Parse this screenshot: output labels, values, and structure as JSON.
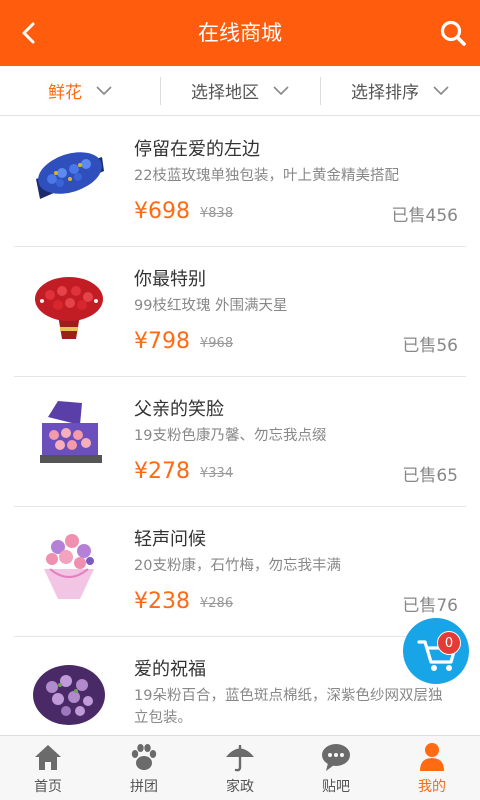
{
  "header": {
    "title": "在线商城"
  },
  "filters": [
    {
      "label": "鲜花"
    },
    {
      "label": "选择地区"
    },
    {
      "label": "选择排序"
    }
  ],
  "products": [
    {
      "name": "停留在爱的左边",
      "desc": "22枝蓝玫瑰单独包装，叶上黄金精美搭配",
      "price": "¥698",
      "original_price": "¥838",
      "sold": "已售456"
    },
    {
      "name": "你最特别",
      "desc": "99枝红玫瑰 外围满天星",
      "price": "¥798",
      "original_price": "¥968",
      "sold": "已售56"
    },
    {
      "name": "父亲的笑脸",
      "desc": "19支粉色康乃馨、勿忘我点缀",
      "price": "¥278",
      "original_price": "¥334",
      "sold": "已售65"
    },
    {
      "name": "轻声问候",
      "desc": "20支粉康，石竹梅，勿忘我丰满",
      "price": "¥238",
      "original_price": "¥286",
      "sold": "已售76"
    },
    {
      "name": "爱的祝福",
      "desc": "19朵粉百合，蓝色斑点棉纸，深紫色纱网双层独立包装。",
      "price": "",
      "original_price": "",
      "sold": ""
    }
  ],
  "cart": {
    "count": "0"
  },
  "tabs": [
    {
      "label": "首页",
      "icon": "home-icon"
    },
    {
      "label": "拼团",
      "icon": "paw-icon"
    },
    {
      "label": "家政",
      "icon": "umbrella-icon"
    },
    {
      "label": "贴吧",
      "icon": "chat-icon"
    },
    {
      "label": "我的",
      "icon": "user-icon"
    }
  ],
  "colors": {
    "brand": "#ff5c0d",
    "price": "#ff6a13",
    "cart": "#18a5e7",
    "badge": "#e43b36"
  }
}
